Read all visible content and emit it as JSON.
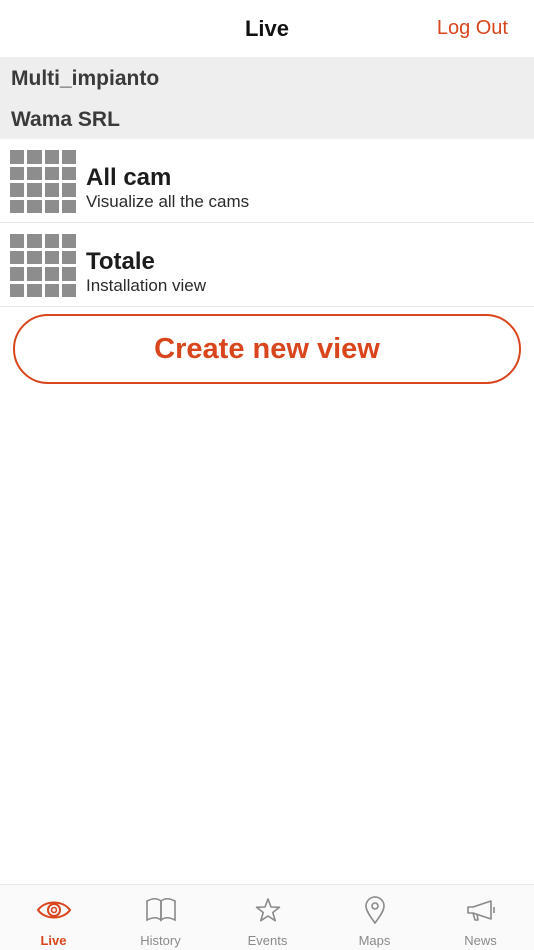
{
  "navbar": {
    "title": "Live",
    "logout_label": "Log Out"
  },
  "group": {
    "line1": "Multi_impianto",
    "line2": "Wama SRL"
  },
  "views": [
    {
      "title": "All cam",
      "subtitle": "Visualize all the cams",
      "icon": "grid-icon"
    },
    {
      "title": "Totale",
      "subtitle": "Installation view",
      "icon": "grid-icon"
    }
  ],
  "create_button": {
    "label": "Create new view"
  },
  "tabbar": {
    "tabs": [
      {
        "label": "Live",
        "icon": "eye-icon",
        "active": true
      },
      {
        "label": "History",
        "icon": "book-icon",
        "active": false
      },
      {
        "label": "Events",
        "icon": "star-icon",
        "active": false
      },
      {
        "label": "Maps",
        "icon": "map-pin-icon",
        "active": false
      },
      {
        "label": "News",
        "icon": "megaphone-icon",
        "active": false
      }
    ]
  },
  "colors": {
    "accent": "#d9461d",
    "inactive": "#8a8a8a",
    "group_bg": "#eeeeee"
  }
}
